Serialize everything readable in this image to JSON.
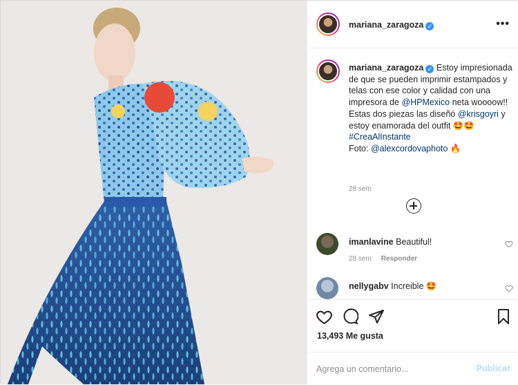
{
  "header": {
    "username": "mariana_zaragoza",
    "more_label": "•••"
  },
  "caption": {
    "username": "mariana_zaragoza",
    "text_parts": {
      "p1": " Estoy impresionada de que se pueden imprimir estampados y telas con ese color y calidad con una impresora de ",
      "mention1": "@HPMexico",
      "p2": " neta woooow!! Estas dos piezas las diseñó ",
      "mention2": "@krisgoyri",
      "p3": " y estoy enamorada del outfit ",
      "emoji1": "🤩🤩",
      "hashtag": "#CreaAlInstante",
      "foto_label": "Foto: ",
      "mention3": "@alexcordovaphoto",
      "emoji2": " 🔥"
    },
    "time": "28 sem"
  },
  "comments": [
    {
      "username": "imanlavine",
      "text": "Beautiful!",
      "time": "28 sem",
      "reply_label": "Responder"
    },
    {
      "username": "nellygabv",
      "text": "Increible 🤩"
    }
  ],
  "likes": "13,493 Me gusta",
  "add_comment": {
    "placeholder": "Agrega un comentario...",
    "publish_label": "Publicar"
  },
  "colors": {
    "accent": "#3897f0",
    "link": "#00376b",
    "publish_disabled": "#b2dffc",
    "meta_gray": "#8e8e8e"
  },
  "icons": [
    "verified-badge-icon",
    "more-options-icon",
    "load-more-comments-icon",
    "heart-icon",
    "comment-icon",
    "share-icon",
    "bookmark-icon"
  ]
}
